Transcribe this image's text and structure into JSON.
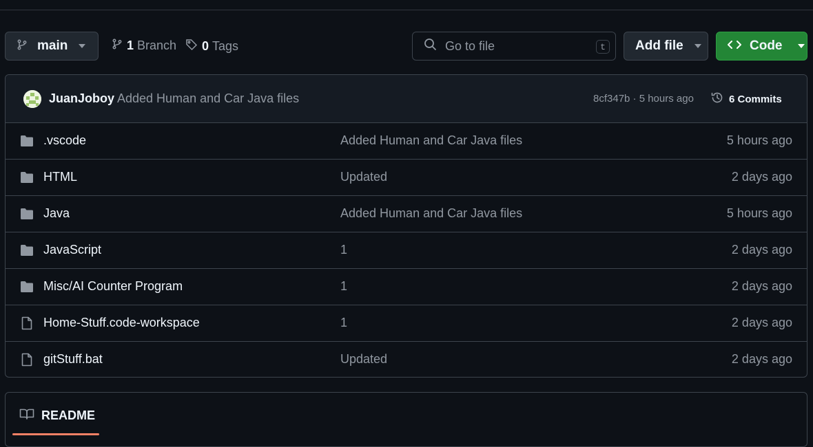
{
  "toolbar": {
    "branch_label": "main",
    "branches_count": "1",
    "branches_label": "Branch",
    "tags_count": "0",
    "tags_label": "Tags",
    "search_placeholder": "Go to file",
    "search_shortcut": "t",
    "add_file_label": "Add file",
    "code_label": "Code"
  },
  "latest_commit": {
    "author": "JuanJoboy",
    "message": "Added Human and Car Java files",
    "meta": "8cf347b · 5 hours ago",
    "commits_label": "6 Commits"
  },
  "files": [
    {
      "name": ".vscode",
      "type": "folder",
      "message": "Added Human and Car Java files",
      "date": "5 hours ago"
    },
    {
      "name": "HTML",
      "type": "folder",
      "message": "Updated",
      "date": "2 days ago"
    },
    {
      "name": "Java",
      "type": "folder",
      "message": "Added Human and Car Java files",
      "date": "5 hours ago"
    },
    {
      "name": "JavaScript",
      "type": "folder",
      "message": "1",
      "date": "2 days ago"
    },
    {
      "name": "Misc/AI Counter Program",
      "type": "folder",
      "message": "1",
      "date": "2 days ago"
    },
    {
      "name": "Home-Stuff.code-workspace",
      "type": "file",
      "message": "1",
      "date": "2 days ago"
    },
    {
      "name": "gitStuff.bat",
      "type": "file",
      "message": "Updated",
      "date": "2 days ago"
    }
  ],
  "readme": {
    "tab_label": "README"
  },
  "colors": {
    "background": "#0d1117",
    "accent_green": "#238636",
    "tab_underline": "#f78166",
    "muted_text": "#9198a1"
  },
  "icons": {
    "branch": "git-branch-icon",
    "tag": "tag-icon",
    "search": "search-icon",
    "code": "code-icon",
    "history": "history-icon",
    "folder": "folder-icon",
    "file": "file-icon",
    "book": "book-icon"
  }
}
